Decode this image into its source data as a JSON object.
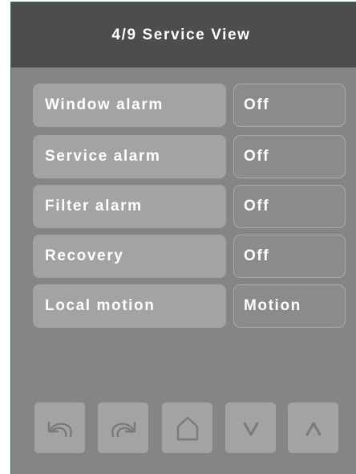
{
  "header": {
    "title": "4/9 Service View"
  },
  "settings": [
    {
      "label": "Window alarm",
      "value": "Off"
    },
    {
      "label": "Service alarm",
      "value": "Off"
    },
    {
      "label": "Filter alarm",
      "value": "Off"
    },
    {
      "label": "Recovery",
      "value": "Off"
    },
    {
      "label": "Local motion",
      "value": "Motion"
    }
  ],
  "nav": {
    "buttons": [
      "undo-icon",
      "redo-icon",
      "home-icon",
      "chevron-down-icon",
      "chevron-up-icon"
    ]
  },
  "colors": {
    "background": "#858585",
    "header": "#4d4d4d",
    "label_bg": "#a3a3a3",
    "value_bg": "#8b8b8b",
    "text": "#ffffff",
    "icon": "#7a7a7a"
  }
}
